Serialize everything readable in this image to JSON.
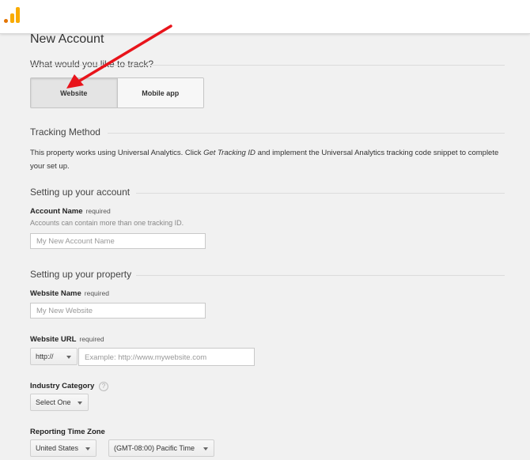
{
  "page": {
    "title": "New Account",
    "track_question": "What would you like to track?",
    "track_options": {
      "website": "Website",
      "mobile": "Mobile app"
    }
  },
  "tracking": {
    "title": "Tracking Method",
    "text_before": "This property works using Universal Analytics. Click ",
    "link": "Get Tracking ID",
    "text_after": " and implement the Universal Analytics tracking code snippet to complete your set up."
  },
  "account": {
    "title": "Setting up your account",
    "name_label": "Account Name",
    "required": "required",
    "hint": "Accounts can contain more than one tracking ID.",
    "placeholder": "My New Account Name"
  },
  "property": {
    "title": "Setting up your property",
    "website_name_label": "Website Name",
    "website_name_placeholder": "My New Website",
    "url_label": "Website URL",
    "protocol": "http://",
    "url_placeholder": "Example: http://www.mywebsite.com",
    "industry_label": "Industry Category",
    "industry_value": "Select One",
    "help_glyph": "?",
    "timezone_label": "Reporting Time Zone",
    "country_value": "United States",
    "timezone_value": "(GMT-08:00) Pacific Time"
  },
  "colors": {
    "accent_arrow": "#e8141b",
    "logo_orange": "#f9ab00"
  },
  "icons": [
    "analytics-logo-icon",
    "help-icon",
    "chevron-down-icon",
    "red-arrow-annotation"
  ]
}
